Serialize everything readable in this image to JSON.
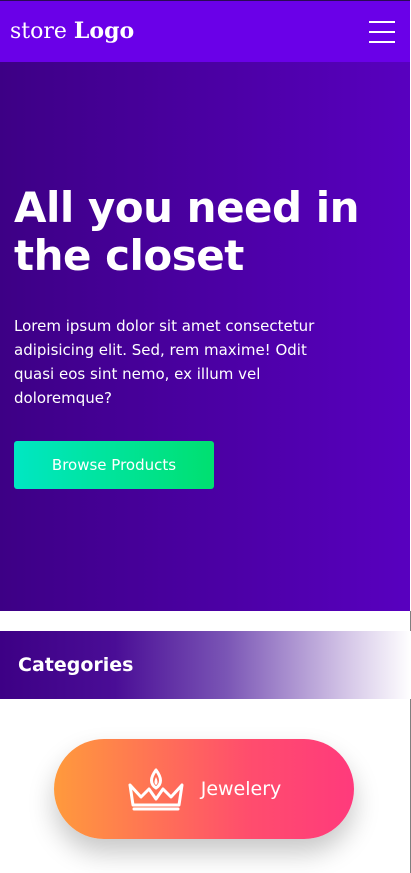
{
  "header": {
    "brand_store": "store",
    "brand_logo": "Logo",
    "menu_icon": "hamburger-menu-icon",
    "background": "#6a00e8"
  },
  "hero": {
    "title": "All you need in the closet",
    "text": "Lorem ipsum dolor sit amet consectetur adipisicing elit. Sed, rem maxime! Odit quasi eos sint nemo, ex illum vel doloremque?",
    "cta_label": "Browse Products",
    "background_from": "#3d0085",
    "background_to": "#5800bf",
    "cta_color_from": "#00e7c3",
    "cta_color_to": "#00e070"
  },
  "categories": {
    "title": "Categories",
    "items": [
      {
        "label": "Jewelery",
        "icon": "crown-icon",
        "color_from": "#ff9a3c",
        "color_to": "#ff3a7c"
      }
    ]
  }
}
